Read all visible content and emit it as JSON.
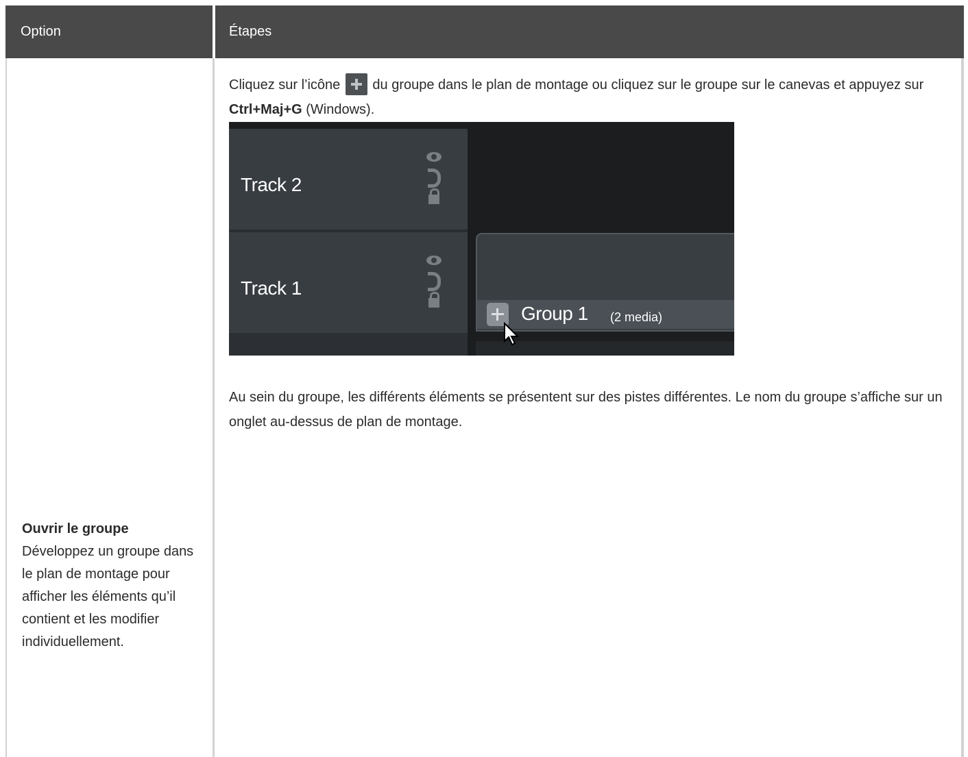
{
  "table": {
    "headers": {
      "option": "Option",
      "steps": "Étapes"
    },
    "row": {
      "option_title": "Ouvrir le groupe",
      "option_description": "Développez un groupe dans le plan de montage pour afficher les éléments qu’il contient et les modifier individuellement.",
      "steps_p1_before_icon": "Cliquez sur l’icône",
      "steps_p1_after_icon": "du groupe dans le plan de montage ou cliquez sur le groupe sur le canevas et appuyez sur",
      "steps_p1_shortcut": "Ctrl+Maj+G",
      "steps_p1_end": "(Windows).",
      "steps_p2": "Au sein du groupe, les différents éléments se présentent sur des pistes différentes. Le nom du groupe s’affiche sur un onglet au-dessus de plan de montage."
    }
  },
  "screenshot": {
    "tracks": [
      {
        "label": "Track 2"
      },
      {
        "label": "Track 1"
      }
    ],
    "group_name": "Group 1",
    "group_media_count": "(2 media)",
    "colors": {
      "timeline_bg": "#1b1d1f",
      "track_header_bg": "#383d42",
      "clip_bg": "#393e43",
      "header_bg": "#494949"
    }
  }
}
